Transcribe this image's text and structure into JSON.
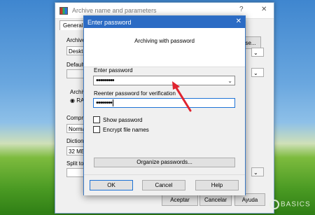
{
  "background_window": {
    "title": "Archive name and parameters",
    "help_glyph": "?",
    "close_glyph": "✕",
    "tab_general": "General",
    "archive_label": "Archive",
    "archive_value": "Deskto",
    "browse_fragment": "se...",
    "default_label": "Default",
    "archiving_label": "Archiv",
    "radio_label": "RA",
    "compression_label": "Compre",
    "compression_value": "Norma",
    "dictionary_label": "Diction",
    "dictionary_value": "32 MB",
    "split_label": "Split to",
    "accept_button": "Aceptar",
    "cancel_button": "Cancelar",
    "help_button": "Ayuda"
  },
  "dialog": {
    "title": "Enter password",
    "close_glyph": "✕",
    "heading": "Archiving with password",
    "enter_label": "Enter password",
    "enter_value": "•••••••••",
    "reenter_label": "Reenter password for verification",
    "reenter_value": "••••••••",
    "show_password_label": "Show password",
    "encrypt_names_label": "Encrypt file names",
    "organize_button": "Organize passwords...",
    "ok_button": "OK",
    "cancel_button": "Cancel",
    "help_button": "Help"
  },
  "colors": {
    "annotation_arrow": "#e0242f",
    "title_bar": "#2b6bc4"
  },
  "watermark": "BASICS"
}
